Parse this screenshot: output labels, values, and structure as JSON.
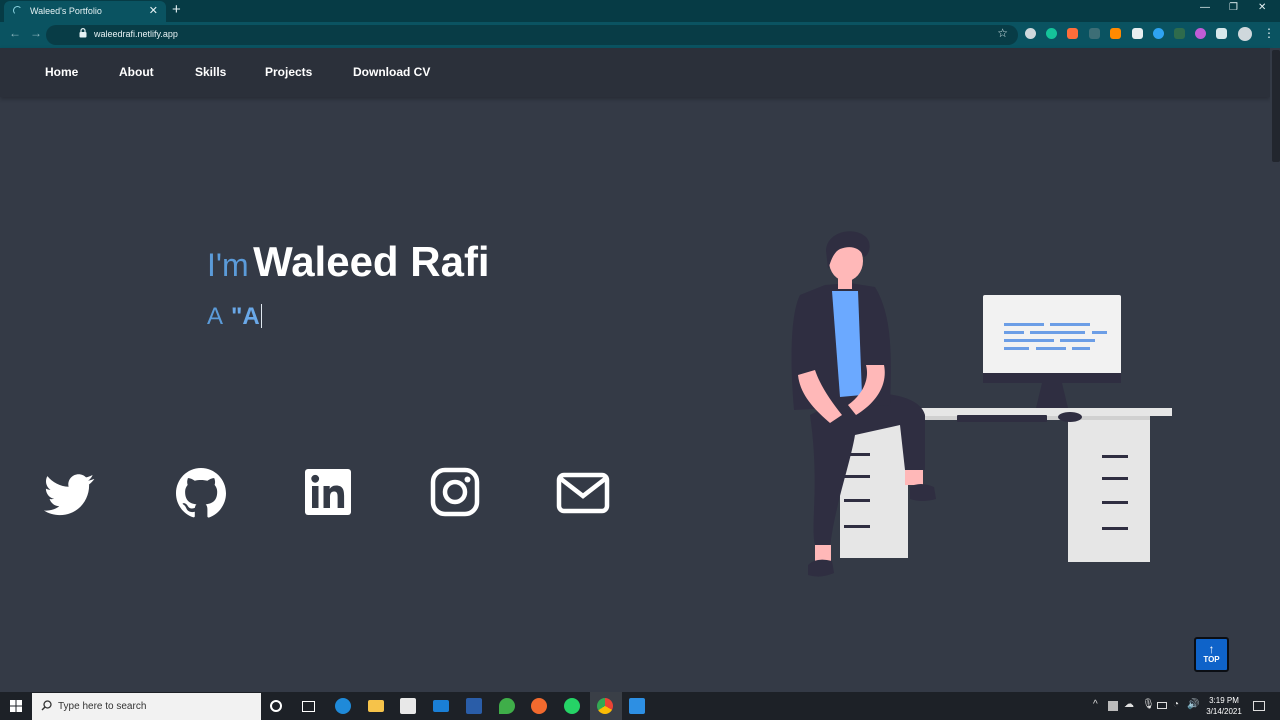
{
  "browser": {
    "tab_title": "Waleed's Portfolio",
    "url": "waleedrafi.netlify.app"
  },
  "nav": {
    "items": [
      "Home",
      "About",
      "Skills",
      "Projects",
      "Download CV"
    ]
  },
  "hero": {
    "greeting": "I'm",
    "name": "Waleed Rafi",
    "prefix": "A",
    "typed_text": "\"A"
  },
  "social": [
    "twitter-icon",
    "github-icon",
    "linkedin-icon",
    "instagram-icon",
    "mail-icon"
  ],
  "top_button": {
    "label": "TOP"
  },
  "taskbar": {
    "search_placeholder": "Type here to search",
    "time": "3:19 PM",
    "date": "3/14/2021"
  },
  "colors": {
    "page_bg": "#343a46",
    "nav_bg": "#2b303a",
    "accent": "#5b9bd9",
    "browser_frame": "#0a5361"
  }
}
